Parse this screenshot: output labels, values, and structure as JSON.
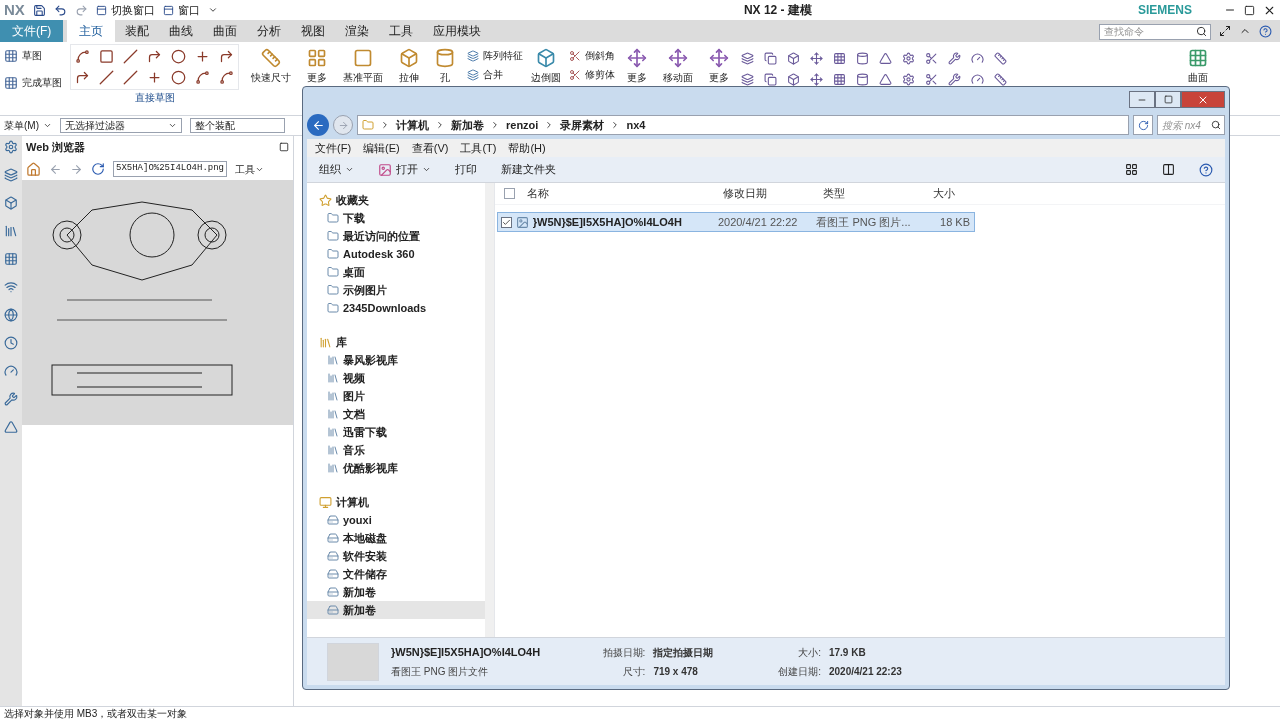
{
  "app": {
    "logo": "NX",
    "title": "NX 12 - 建模",
    "brand": "SIEMENS",
    "quick_access": [
      {
        "label": "切换窗口"
      },
      {
        "label": "窗口"
      }
    ]
  },
  "ribbon": {
    "tabs": [
      {
        "label": "文件(F)",
        "kind": "file",
        "selected": false
      },
      {
        "label": "主页",
        "kind": "tab",
        "selected": true
      },
      {
        "label": "装配",
        "kind": "tab",
        "selected": false
      },
      {
        "label": "曲线",
        "kind": "tab",
        "selected": false
      },
      {
        "label": "曲面",
        "kind": "tab",
        "selected": false
      },
      {
        "label": "分析",
        "kind": "tab",
        "selected": false
      },
      {
        "label": "视图",
        "kind": "tab",
        "selected": false
      },
      {
        "label": "渲染",
        "kind": "tab",
        "selected": false
      },
      {
        "label": "工具",
        "kind": "tab",
        "selected": false
      },
      {
        "label": "应用模块",
        "kind": "tab",
        "selected": false
      }
    ],
    "search_placeholder": "查找命令",
    "sketch_buttons": [
      "草图",
      "完成草图"
    ],
    "sketch_group_label": "直接草图",
    "large_buttons": [
      "快速尺寸",
      "更多",
      "基准平面",
      "拉伸",
      "孔"
    ],
    "feature_small": [
      "阵列特征",
      "合并"
    ],
    "blend_button": "边倒圆",
    "edit_small": [
      "倒斜角",
      "修剪体"
    ],
    "more_buttons": [
      "更多",
      "移动面",
      "更多"
    ],
    "surface_button": "曲面"
  },
  "selection_bar": {
    "menu": "菜单(M)",
    "filter": "无选择过滤器",
    "scope": "整个装配"
  },
  "web_browser": {
    "title": "Web 浏览器",
    "url": "5X5HA]O%25I4LO4H.png",
    "tools": "工具"
  },
  "explorer": {
    "breadcrumb": [
      "计算机",
      "新加卷",
      "renzoi",
      "录屏素材",
      "nx4"
    ],
    "search_placeholder": "搜索 nx4",
    "menu": [
      "文件(F)",
      "编辑(E)",
      "查看(V)",
      "工具(T)",
      "帮助(H)"
    ],
    "toolbar": [
      {
        "label": "组织",
        "kind": "dropdown"
      },
      {
        "label": "打开",
        "kind": "open"
      },
      {
        "label": "打印",
        "kind": "plain"
      },
      {
        "label": "新建文件夹",
        "kind": "plain"
      }
    ],
    "nav": [
      {
        "label": "收藏夹",
        "kind": "favorites",
        "children": [
          {
            "label": "下载",
            "selected": false
          },
          {
            "label": "最近访问的位置",
            "selected": false
          },
          {
            "label": "Autodesk 360",
            "selected": false
          },
          {
            "label": "桌面",
            "selected": false
          },
          {
            "label": "示例图片",
            "selected": false
          },
          {
            "label": "2345Downloads",
            "selected": false
          }
        ]
      },
      {
        "label": "库",
        "kind": "library",
        "children": [
          {
            "label": "暴风影视库",
            "selected": false
          },
          {
            "label": "视频",
            "selected": false
          },
          {
            "label": "图片",
            "selected": false
          },
          {
            "label": "文档",
            "selected": false
          },
          {
            "label": "迅雷下载",
            "selected": false
          },
          {
            "label": "音乐",
            "selected": false
          },
          {
            "label": "优酷影视库",
            "selected": false
          }
        ]
      },
      {
        "label": "计算机",
        "kind": "computer",
        "children": [
          {
            "label": "youxi",
            "selected": false
          },
          {
            "label": "本地磁盘",
            "selected": false
          },
          {
            "label": "软件安装",
            "selected": false
          },
          {
            "label": "文件储存",
            "selected": false
          },
          {
            "label": "新加卷",
            "selected": false
          },
          {
            "label": "新加卷",
            "selected": true
          }
        ]
      }
    ],
    "columns": [
      "名称",
      "修改日期",
      "类型",
      "大小"
    ],
    "select_all_checked": false,
    "files": [
      {
        "name": "}W5N}$E]I5X5HA]O%I4LO4H",
        "date": "2020/4/21 22:22",
        "type": "看图王 PNG 图片...",
        "size": "18 KB",
        "selected": true,
        "checked": true
      }
    ],
    "details": {
      "name": "}W5N}$E]I5X5HA]O%I4LO4H",
      "type": "看图王 PNG 图片文件",
      "fields": [
        {
          "label": "拍摄日期:",
          "value": "指定拍摄日期"
        },
        {
          "label": "尺寸:",
          "value": "719 x 478"
        },
        {
          "label": "大小:",
          "value": "17.9 KB"
        },
        {
          "label": "创建日期:",
          "value": "2020/4/21 22:23"
        }
      ]
    }
  },
  "status_bar": "选择对象并使用 MB3，或者双击某一对象"
}
